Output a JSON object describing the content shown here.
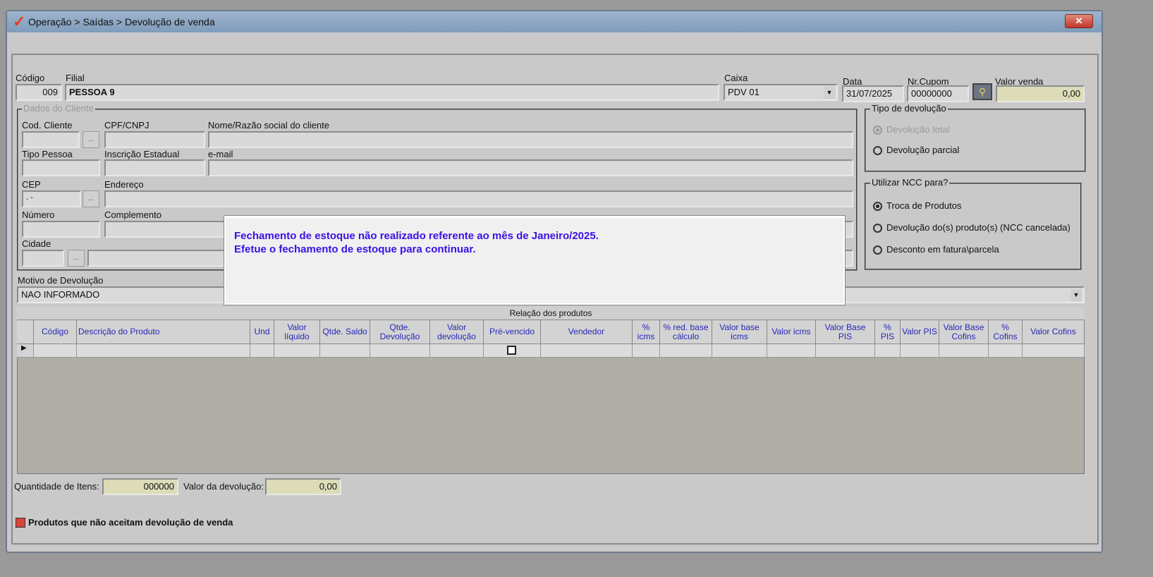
{
  "window": {
    "title": "Operação > Saídas > Devolução de venda",
    "close": "✕"
  },
  "header": {
    "codigo_label": "Código",
    "codigo": "009",
    "filial_label": "Filial",
    "filial": "PESSOA 9",
    "caixa_label": "Caixa",
    "caixa": "PDV 01",
    "data_label": "Data",
    "data": "31/07/2025",
    "cupom_label": "Nr.Cupom",
    "cupom": "00000000",
    "valor_venda_label": "Valor venda",
    "valor_venda": "0,00"
  },
  "cliente": {
    "legend": "Dados do Cliente",
    "cod_cliente": "Cod. Cliente",
    "cpf": "CPF/CNPJ",
    "nome": "Nome/Razão social do cliente",
    "tipo_pessoa": "Tipo Pessoa",
    "ie": "Inscrição Estadual",
    "email": "e-mail",
    "cep": "CEP",
    "cep_value": " .  -",
    "endereco": "Endereço",
    "numero": "Número",
    "complemento": "Complemento",
    "cidade": "Cidade",
    "ellipsis": "..."
  },
  "tipo_devolucao": {
    "legend": "Tipo de devolução",
    "options": [
      "Devolução total",
      "Devolução parcial"
    ]
  },
  "ncc": {
    "legend": "Utilizar NCC para?",
    "options": [
      "Troca de Produtos",
      "Devolução do(s) produto(s) (NCC cancelada)",
      "Desconto em fatura\\parcela"
    ]
  },
  "motivo": {
    "label": "Motivo de Devolução",
    "value": "NAO INFORMADO"
  },
  "grid": {
    "title": "Relação dos produtos",
    "headers": [
      "",
      "Código",
      "Descrição do Produto",
      "Und",
      "Valor líquido",
      "Qtde. Saldo",
      "Qtde. Devolução",
      "Valor devolução",
      "Pré-vencido",
      "Vendedor",
      "% icms",
      "% red. base cálculo",
      "Valor base icms",
      "Valor icms",
      "Valor Base PIS",
      "% PIS",
      "Valor PIS",
      "Valor Base Cofins",
      "% Cofins",
      "Valor Cofins"
    ]
  },
  "footer": {
    "qtd_label": "Quantidade de Itens:",
    "qtd": "000000",
    "valor_label": "Valor da devolução:",
    "valor": "0,00",
    "legend_text": "Produtos que não aceitam devolução de venda",
    "legend_color": "#d9443a"
  },
  "dialog": {
    "line1": "Fechamento de estoque não realizado referente ao mês de Janeiro/2025.",
    "line2": "Efetue o fechamento de estoque para continuar."
  }
}
